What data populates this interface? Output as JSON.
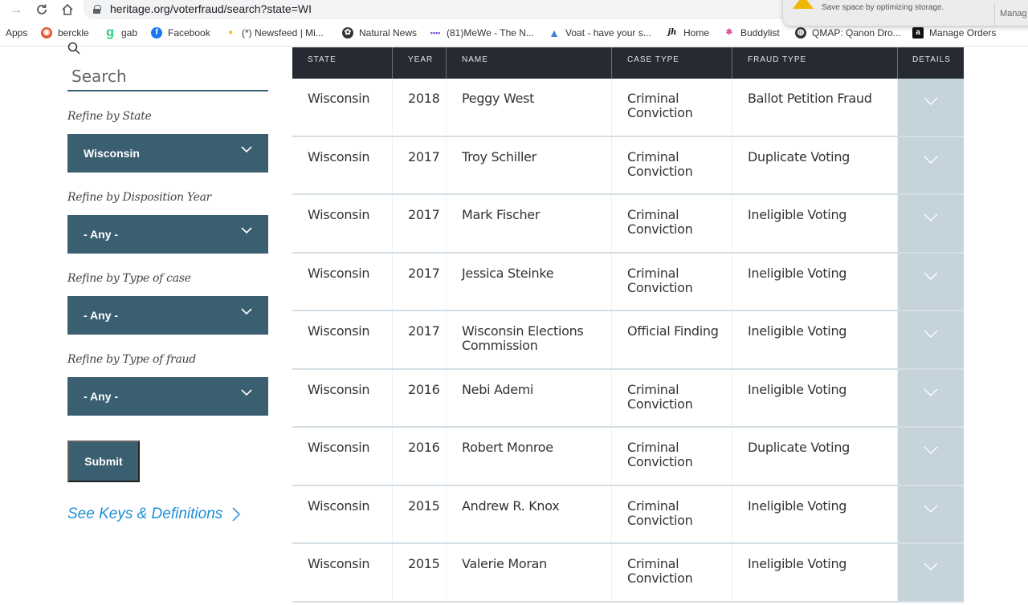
{
  "browser": {
    "url": "heritage.org/voterfraud/search?state=WI",
    "bookmarks": [
      {
        "label": "Apps",
        "icon": "apps-icon"
      },
      {
        "label": "berckle",
        "icon": "duckduckgo-icon"
      },
      {
        "label": "gab",
        "icon": "gab-icon"
      },
      {
        "label": "Facebook",
        "icon": "facebook-icon"
      },
      {
        "label": "(*) Newsfeed | Mi...",
        "icon": "lightbulb-icon"
      },
      {
        "label": "Natural News",
        "icon": "natural-news-icon"
      },
      {
        "label": "(81)MeWe - The N...",
        "icon": "mewe-icon"
      },
      {
        "label": "Voat - have your s...",
        "icon": "voat-icon"
      },
      {
        "label": "Home",
        "icon": "jh-icon"
      },
      {
        "label": "Buddylist",
        "icon": "buddylist-icon"
      },
      {
        "label": "QMAP: Qanon Dro...",
        "icon": "globe-icon"
      },
      {
        "label": "Manage Orders",
        "icon": "amazon-icon"
      }
    ],
    "notification": {
      "text": "Save space by optimizing storage.",
      "button": "Manag"
    }
  },
  "sidebar": {
    "search_placeholder": "Search",
    "filters": [
      {
        "label": "Refine by State",
        "value": "Wisconsin"
      },
      {
        "label": "Refine by Disposition Year",
        "value": "- Any -"
      },
      {
        "label": "Refine by Type of case",
        "value": "- Any -"
      },
      {
        "label": "Refine by Type of fraud",
        "value": "- Any -"
      }
    ],
    "submit_label": "Submit",
    "keys_link": "See Keys & Definitions"
  },
  "table": {
    "headers": [
      "STATE",
      "YEAR",
      "NAME",
      "CASE TYPE",
      "FRAUD TYPE",
      "DETAILS"
    ],
    "rows": [
      {
        "state": "Wisconsin",
        "year": "2018",
        "name": "Peggy West",
        "case_type": "Criminal Conviction",
        "fraud_type": "Ballot Petition Fraud"
      },
      {
        "state": "Wisconsin",
        "year": "2017",
        "name": "Troy Schiller",
        "case_type": "Criminal Conviction",
        "fraud_type": "Duplicate Voting"
      },
      {
        "state": "Wisconsin",
        "year": "2017",
        "name": "Mark Fischer",
        "case_type": "Criminal Conviction",
        "fraud_type": "Ineligible Voting"
      },
      {
        "state": "Wisconsin",
        "year": "2017",
        "name": "Jessica Steinke",
        "case_type": "Criminal Conviction",
        "fraud_type": "Ineligible Voting"
      },
      {
        "state": "Wisconsin",
        "year": "2017",
        "name": "Wisconsin Elections Commission",
        "case_type": "Official Finding",
        "fraud_type": "Ineligible Voting"
      },
      {
        "state": "Wisconsin",
        "year": "2016",
        "name": "Nebi Ademi",
        "case_type": "Criminal Conviction",
        "fraud_type": "Ineligible Voting"
      },
      {
        "state": "Wisconsin",
        "year": "2016",
        "name": "Robert Monroe",
        "case_type": "Criminal Conviction",
        "fraud_type": "Duplicate Voting"
      },
      {
        "state": "Wisconsin",
        "year": "2015",
        "name": "Andrew R. Knox",
        "case_type": "Criminal Conviction",
        "fraud_type": "Ineligible Voting"
      },
      {
        "state": "Wisconsin",
        "year": "2015",
        "name": "Valerie Moran",
        "case_type": "Criminal Conviction",
        "fraud_type": "Ineligible Voting"
      }
    ]
  }
}
